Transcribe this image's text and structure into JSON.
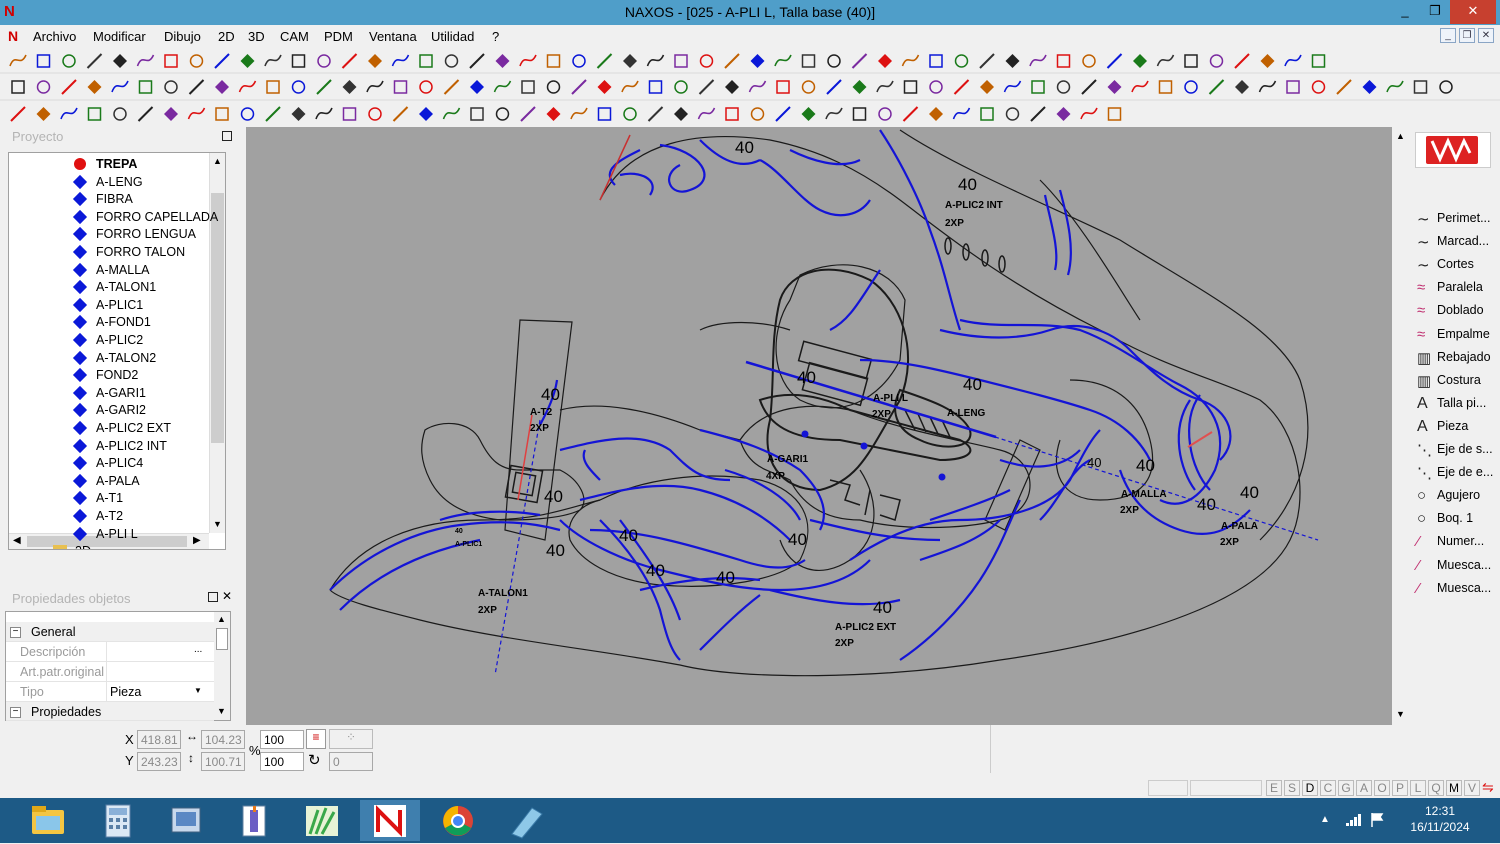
{
  "window": {
    "title": "NAXOS - [025 - A-PLI L, Talla base (40)]",
    "buttons": [
      "_",
      "❐",
      "✕"
    ]
  },
  "menu": {
    "items": [
      "Archivo",
      "Modificar",
      "Dibujo",
      "2D",
      "3D",
      "CAM",
      "PDM",
      "Ventana",
      "Utilidad",
      "?"
    ]
  },
  "project_panel": {
    "title": "Proyecto",
    "items": [
      {
        "label": "TREPA",
        "selected": true
      },
      {
        "label": "A-LENG"
      },
      {
        "label": "FIBRA"
      },
      {
        "label": "FORRO CAPELLADA"
      },
      {
        "label": "FORRO LENGUA"
      },
      {
        "label": "FORRO TALON"
      },
      {
        "label": "A-MALLA"
      },
      {
        "label": "A-TALON1"
      },
      {
        "label": "A-PLIC1"
      },
      {
        "label": "A-FOND1"
      },
      {
        "label": "A-PLIC2"
      },
      {
        "label": "A-TALON2"
      },
      {
        "label": "FOND2"
      },
      {
        "label": "A-GARI1"
      },
      {
        "label": "A-GARI2"
      },
      {
        "label": "A-PLIC2 EXT"
      },
      {
        "label": "A-PLIC2 INT"
      },
      {
        "label": "A-PLIC4"
      },
      {
        "label": "A-PALA"
      },
      {
        "label": "A-T1"
      },
      {
        "label": "A-T2"
      },
      {
        "label": "A-PLI L"
      }
    ],
    "partial_item": "2D"
  },
  "properties_panel": {
    "title": "Propiedades objetos",
    "group_general": "General",
    "rows": [
      {
        "key": "Descripción",
        "value": ""
      },
      {
        "key": "Art.patr.original",
        "value": ""
      },
      {
        "key": "Tipo",
        "value": "Pieza"
      }
    ],
    "group_props": "Propiedades"
  },
  "canvas": {
    "labels": [
      {
        "text": "40"
      },
      {
        "text": "40"
      },
      {
        "text": "A-PLIC2 INT"
      },
      {
        "text": "2XP"
      },
      {
        "text": "40"
      },
      {
        "text": "A-T2"
      },
      {
        "text": "2XP"
      },
      {
        "text": "40"
      },
      {
        "text": "A-PLI L"
      },
      {
        "text": "2XP"
      },
      {
        "text": "40"
      },
      {
        "text": "A-LENG"
      },
      {
        "text": "A-GARI1"
      },
      {
        "text": "4XP"
      },
      {
        "text": "40"
      },
      {
        "text": "40"
      },
      {
        "text": "A-MALLA"
      },
      {
        "text": "2XP"
      },
      {
        "text": "40"
      },
      {
        "text": "40"
      },
      {
        "text": "A-PALA"
      },
      {
        "text": "2XP"
      },
      {
        "text": "40"
      },
      {
        "text": "40"
      },
      {
        "text": "40"
      },
      {
        "text": "40"
      },
      {
        "text": "40"
      },
      {
        "text": "40"
      },
      {
        "text": "A-TALON1"
      },
      {
        "text": "2XP"
      },
      {
        "text": "40"
      },
      {
        "text": "A-PLIC2 EXT"
      },
      {
        "text": "2XP"
      },
      {
        "text": "40"
      },
      {
        "text": "A-PLIC1"
      },
      {
        "text": "2XP"
      }
    ]
  },
  "right_tools": [
    {
      "label": "Perimet...",
      "icon": "perimeter-icon"
    },
    {
      "label": "Marcad...",
      "icon": "marking-icon"
    },
    {
      "label": "Cortes",
      "icon": "cuts-icon"
    },
    {
      "label": "Paralela",
      "icon": "parallel-icon"
    },
    {
      "label": "Doblado",
      "icon": "fold-icon"
    },
    {
      "label": "Empalme",
      "icon": "splice-icon"
    },
    {
      "label": "Rebajado",
      "icon": "skive-icon"
    },
    {
      "label": "Costura",
      "icon": "seam-icon"
    },
    {
      "label": "Talla pi...",
      "icon": "size-text-icon"
    },
    {
      "label": "Pieza",
      "icon": "piece-text-icon"
    },
    {
      "label": "Eje de s...",
      "icon": "axis-icon"
    },
    {
      "label": "Eje de e...",
      "icon": "axis-icon"
    },
    {
      "label": "Agujero",
      "icon": "hole-icon"
    },
    {
      "label": "Boq. 1",
      "icon": "punch-icon"
    },
    {
      "label": "Numer...",
      "icon": "number-icon"
    },
    {
      "label": "Muesca...",
      "icon": "notch-icon"
    },
    {
      "label": "Muesca...",
      "icon": "notch-icon"
    }
  ],
  "coords": {
    "x_label": "X",
    "y_label": "Y",
    "x": "418.81",
    "y": "243.23",
    "w": "104.23",
    "h": "100.71",
    "pct_label": "%",
    "scale_x": "100",
    "scale_y": "100",
    "rotation": "0"
  },
  "status_flags": [
    "E",
    "S",
    "D",
    "C",
    "G",
    "A",
    "O",
    "P",
    "L",
    "Q",
    "M",
    "V"
  ],
  "taskbar": {
    "apps": [
      "explorer-icon",
      "calculator-icon",
      "documents-icon",
      "office-icon",
      "design-icon",
      "naxos-icon",
      "chrome-icon",
      "notes-icon"
    ],
    "time": "12:31",
    "date": "16/11/2024"
  },
  "colors": {
    "titlebar": "#4f9ec9",
    "canvas": "#a1a1a1",
    "piece_blue": "#1414d6",
    "taskbar": "#1d5a86"
  }
}
